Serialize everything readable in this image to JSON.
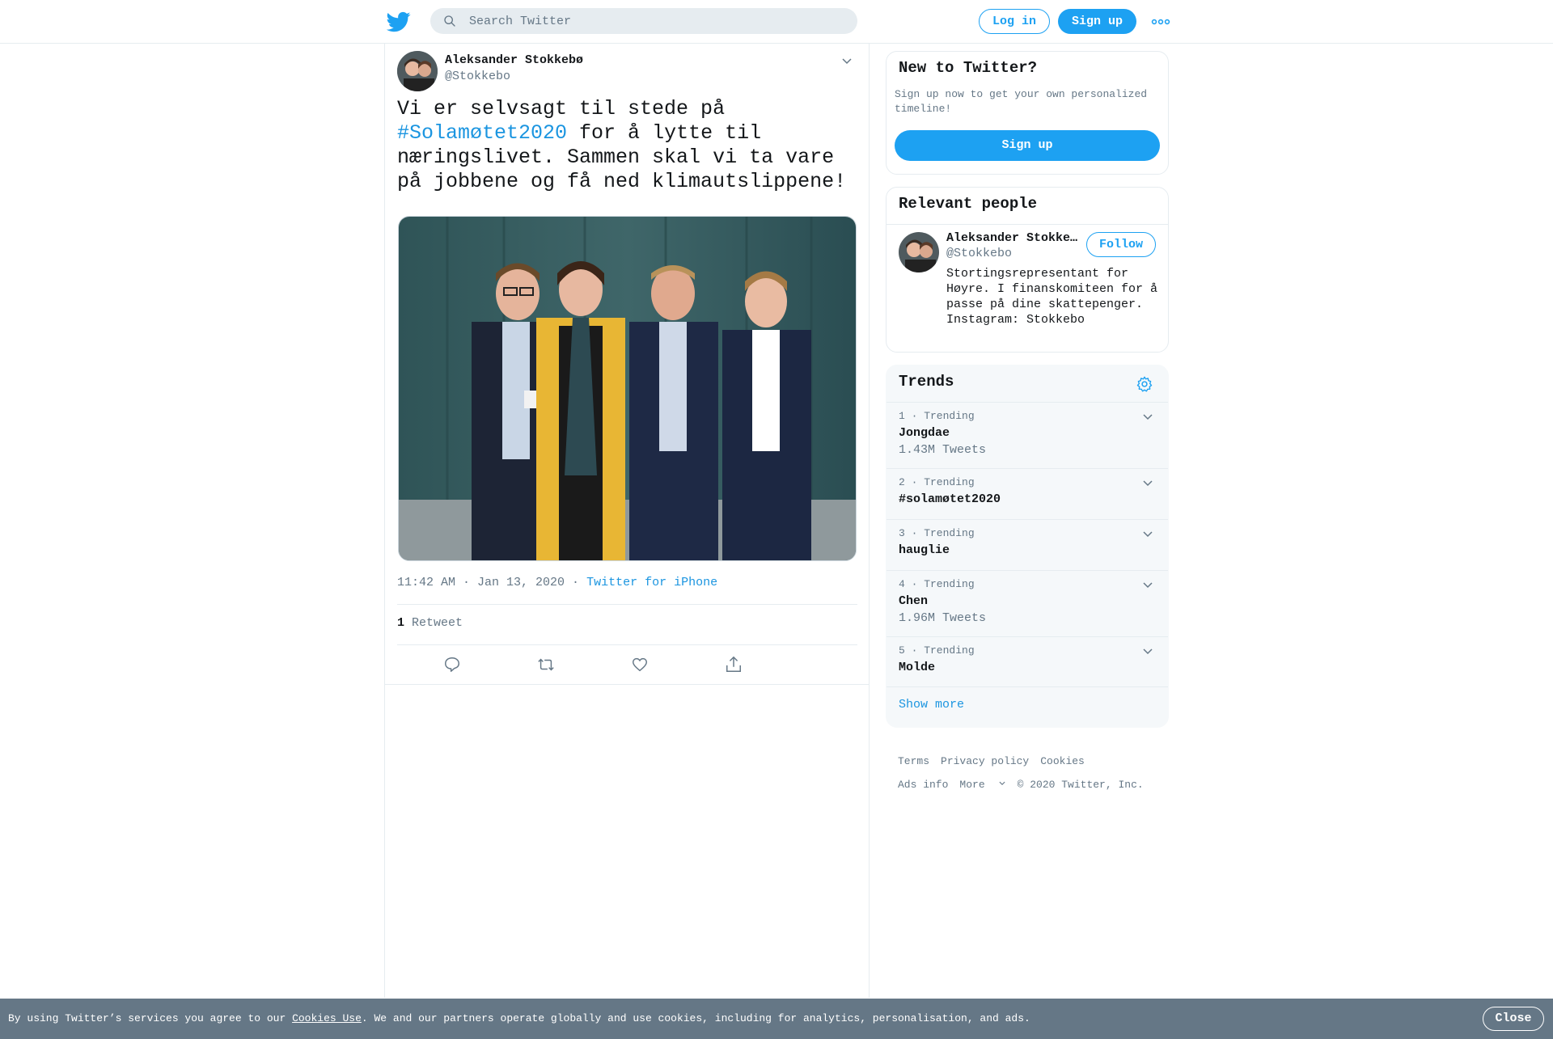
{
  "header": {
    "search_placeholder": "Search Twitter",
    "login_label": "Log in",
    "signup_label": "Sign up",
    "brand_color": "#1da1f2"
  },
  "tweet": {
    "author_name": "Aleksander Stokkebø",
    "author_handle": "@Stokkebo",
    "text_part1": "Vi er selvsagt til stede på ",
    "hashtag": "#Solamøtet2020",
    "text_part2": " for å lytte til næringslivet. Sammen skal vi ta vare på jobbene og få ned klimautslippene!",
    "timestamp": "11:42 AM · Jan 13, 2020",
    "source_sep": " · ",
    "source": "Twitter for iPhone",
    "retweet_count": "1",
    "retweet_label": " Retweet"
  },
  "sidebar": {
    "new_card": {
      "title": "New to Twitter?",
      "text": "Sign up now to get your own personalized timeline!",
      "button": "Sign up"
    },
    "people_card": {
      "title": "Relevant people",
      "name": "Aleksander Stokkebø",
      "handle": "@Stokkebo",
      "follow_label": "Follow",
      "bio": "Stortingsrepresentant for Høyre. I finanskomiteen for å passe på dine skattepenger. Instagram: Stokkebo"
    },
    "trends": {
      "title": "Trends",
      "items": [
        {
          "meta": "1 · Trending",
          "name": "Jongdae",
          "count": "1.43M Tweets"
        },
        {
          "meta": "2 · Trending",
          "name": "#solamøtet2020",
          "count": ""
        },
        {
          "meta": "3 · Trending",
          "name": "hauglie",
          "count": ""
        },
        {
          "meta": "4 · Trending",
          "name": "Chen",
          "count": "1.96M Tweets"
        },
        {
          "meta": "5 · Trending",
          "name": "Molde",
          "count": ""
        }
      ],
      "show_more": "Show more"
    },
    "footer": {
      "terms": "Terms",
      "privacy": "Privacy policy",
      "cookies": "Cookies",
      "ads": "Ads info",
      "more": "More",
      "copyright": "© 2020 Twitter, Inc."
    }
  },
  "cookie_bar": {
    "text_before": "By using Twitter’s services you agree to our ",
    "link": "Cookies Use",
    "text_after": ". We and our partners operate globally and use cookies, including for analytics, personalisation, and ads.",
    "close": "Close"
  }
}
